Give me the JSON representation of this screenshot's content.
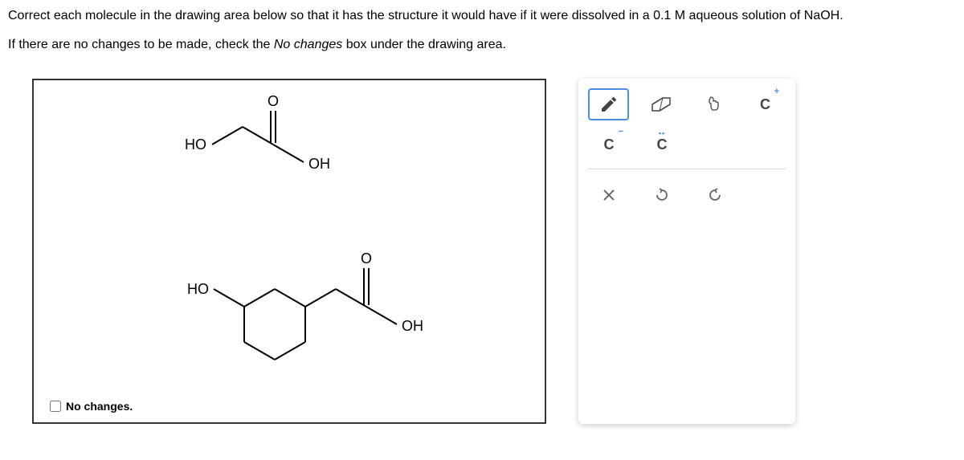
{
  "instructions": {
    "line1_pre": "Correct each molecule in the drawing area below so that it has the structure it would have if it were dissolved in a ",
    "concentration": "0.1 M",
    "line1_post": " aqueous solution of ",
    "compound": "NaOH",
    "line1_end": ".",
    "line2_pre": "If there are no changes to be made, check the ",
    "line2_em": "No changes",
    "line2_post": " box under the drawing area."
  },
  "molecule1": {
    "left_label": "HO",
    "top_label": "O",
    "right_label": "OH"
  },
  "molecule2": {
    "left_label": "HO",
    "top_label": "O",
    "right_label": "OH"
  },
  "no_changes_label": "No changes.",
  "tools": {
    "cplus": "C",
    "cminus": "C",
    "crad": "C"
  }
}
